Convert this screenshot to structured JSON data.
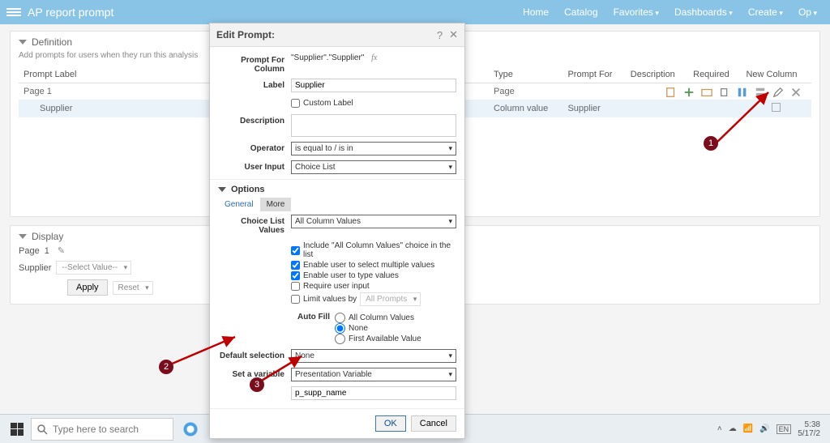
{
  "appbar": {
    "title": "AP report prompt",
    "nav": {
      "home": "Home",
      "catalog": "Catalog",
      "favorites": "Favorites",
      "dashboards": "Dashboards",
      "create": "Create",
      "open": "Op"
    }
  },
  "definition": {
    "heading": "Definition",
    "sub": "Add prompts for users when they run this analysis",
    "columns": {
      "label": "Prompt Label",
      "type": "Type",
      "promptFor": "Prompt For",
      "description": "Description",
      "required": "Required",
      "newColumn": "New Column"
    },
    "rows": [
      {
        "label": "Page 1",
        "type": "Page",
        "promptFor": "",
        "desc": "",
        "req": "",
        "newcol": ""
      },
      {
        "label": "Supplier",
        "type": "Column value",
        "promptFor": "Supplier",
        "desc": "",
        "req": "",
        "newcol": "checkbox"
      }
    ]
  },
  "display": {
    "heading": "Display",
    "pageLabel": "Page",
    "pageVal": "1",
    "promptLabel": "Supplier",
    "selectPlaceholder": "--Select Value--",
    "apply": "Apply",
    "reset": "Reset"
  },
  "modal": {
    "title": "Edit Prompt:",
    "labels": {
      "promptForColumn": "Prompt For Column",
      "label": "Label",
      "customLabel": "Custom Label",
      "description": "Description",
      "operator": "Operator",
      "userInput": "User Input",
      "options": "Options",
      "choiceListValues": "Choice List Values",
      "autoFill": "Auto Fill",
      "defaultSelection": "Default selection",
      "setVariable": "Set a variable"
    },
    "values": {
      "column": "\"Supplier\".\"Supplier\"",
      "labelVal": "Supplier",
      "operator": "is equal to / is in",
      "userInput": "Choice List",
      "tab1": "General",
      "tab2": "More",
      "choiceList": "All Column Values",
      "opt1": "Include \"All Column Values\" choice in the list",
      "opt2": "Enable user to select multiple values",
      "opt3": "Enable user to type values",
      "opt4": "Require user input",
      "opt5pre": "Limit values by",
      "opt5sel": "All Prompts",
      "af1": "All Column Values",
      "af2": "None",
      "af3": "First Available Value",
      "defaultSel": "None",
      "setVar": "Presentation Variable",
      "varName": "p_supp_name",
      "ok": "OK",
      "cancel": "Cancel"
    }
  },
  "taskbar": {
    "searchPlaceholder": "Type here to search",
    "time": "5:38",
    "date": "5/17/2"
  },
  "annotations": {
    "n1": "1",
    "n2": "2",
    "n3": "3"
  }
}
